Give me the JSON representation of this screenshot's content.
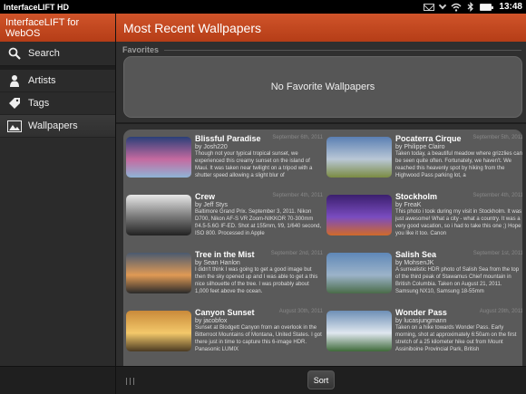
{
  "status_bar": {
    "app_name": "InterfaceLIFT HD",
    "time": "13:48",
    "icons": [
      "mail-icon",
      "chevron-down-icon",
      "wifi-icon",
      "bluetooth-icon",
      "battery-icon"
    ]
  },
  "sidebar": {
    "header_title": "InterfaceLIFT for WebOS",
    "search_label": "Search",
    "items": [
      {
        "label": "Artists",
        "icon": "person-icon"
      },
      {
        "label": "Tags",
        "icon": "tag-icon"
      },
      {
        "label": "Wallpapers",
        "icon": "wallpaper-icon"
      }
    ]
  },
  "main": {
    "title": "Most Recent Wallpapers",
    "favorites_label": "Favorites",
    "favorites_empty": "No Favorite Wallpapers",
    "sort_label": "Sort",
    "wallpapers": [
      {
        "title": "Blissful Paradise",
        "author": "by Josh220",
        "date": "September 6th, 2011",
        "desc": "Though not your typical tropical sunset, we experienced this creamy sunset on the island of Maui. It was taken near twilight on a tripod with a shutter speed allowing a slight blur of",
        "thumb": [
          "#2a3f78",
          "#c56aa0",
          "#8fb4d6"
        ]
      },
      {
        "title": "Pocaterra Cirque",
        "author": "by Philippe Clairo",
        "date": "September 5th, 2011",
        "desc": "Taken today, a beautiful meadow where grizzlies can be seen quite often. Fortunately, we haven't. We reached this heavenly spot by hiking from the Highwood Pass parking lot, a",
        "thumb": [
          "#5a7fb3",
          "#b9c7d6",
          "#7a8b42"
        ]
      },
      {
        "title": "Crew",
        "author": "by Jeff Stys",
        "date": "September 4th, 2011",
        "desc": "Baltimore Grand Prix. September 3, 2011. Nikon D700, Nikon AF-S VR Zoom-NIKKOR 70-300mm f/4.5-5.6G IF-ED. Shot at 155mm, f/9, 1/640 second, ISO 800. Processed in Apple",
        "thumb": [
          "#e8e8e8",
          "#777777",
          "#222222"
        ]
      },
      {
        "title": "Stockholm",
        "author": "by FreaK",
        "date": "September 4th, 2011",
        "desc": "This photo i took during my visit in Stockholm. It was just awesome! What a city - what a country. It was a very good vacation, so i had to take this one ;) Hope you like it too. Canon",
        "thumb": [
          "#3b1f6e",
          "#7a4cc0",
          "#d06a2a"
        ]
      },
      {
        "title": "Tree in the Mist",
        "author": "by Sean Hanlon",
        "date": "September 2nd, 2011",
        "desc": "I didn't think I was going to get a good image but then the sky opened up and I was able to get a this nice silhouette of the tree. I was probably about 1,000 feet above the ocean.",
        "thumb": [
          "#4a5a70",
          "#e09a55",
          "#2a2a2a"
        ]
      },
      {
        "title": "Salish Sea",
        "author": "by MohsenJK",
        "date": "September 1st, 2011",
        "desc": "A surrealistic HDR photo of Salish Sea from the top of the third peak of Stawamus Chief mountain in British Columbia. Taken on August 21, 2011. Samsung NX10, Samsung 18-55mm",
        "thumb": [
          "#5f88b8",
          "#9cb3c9",
          "#4a6b48"
        ]
      },
      {
        "title": "Canyon Sunset",
        "author": "by jacobfox",
        "date": "August 30th, 2011",
        "desc": "Sunset at Blodgett Canyon from an overlook in the Bitterroot Mountains of Montana, United States. I got there just in time to capture this 6-image HDR. Panasonic LUMIX",
        "thumb": [
          "#c98a3a",
          "#f3c86a",
          "#4b3a22"
        ]
      },
      {
        "title": "Wonder Pass",
        "author": "by lucasjungmann",
        "date": "August 29th, 2011",
        "desc": "Taken on a hike towards Wonder Pass. Early morning, shot at approximately 6:50am on the first stretch of a 25 kilometer hike out from Mount Assiniboine Provincial Park, British",
        "thumb": [
          "#6d8fb6",
          "#dfe7ef",
          "#3f6a3a"
        ]
      }
    ]
  }
}
